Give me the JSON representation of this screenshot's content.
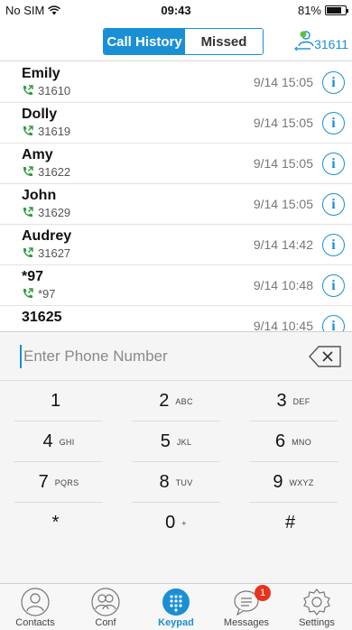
{
  "status": {
    "carrier": "No SIM",
    "time": "09:43",
    "battery": "81%",
    "battery_level": 0.81
  },
  "header": {
    "tabs": [
      {
        "label": "Call History"
      },
      {
        "label": "Missed"
      }
    ],
    "account": "31611"
  },
  "history": [
    {
      "name": "Emily",
      "number": "31610",
      "time": "9/14 15:05"
    },
    {
      "name": "Dolly",
      "number": "31619",
      "time": "9/14 15:05"
    },
    {
      "name": "Amy",
      "number": "31622",
      "time": "9/14 15:05"
    },
    {
      "name": "John",
      "number": "31629",
      "time": "9/14 15:05"
    },
    {
      "name": "Audrey",
      "number": "31627",
      "time": "9/14 14:42"
    },
    {
      "name": "*97",
      "number": "*97",
      "time": "9/14 10:48"
    },
    {
      "name": "31625",
      "number": "",
      "time": "9/14 10:45"
    }
  ],
  "dialer": {
    "placeholder": "Enter Phone Number",
    "keys": [
      {
        "digit": "1",
        "letters": ""
      },
      {
        "digit": "2",
        "letters": "ABC"
      },
      {
        "digit": "3",
        "letters": "DEF"
      },
      {
        "digit": "4",
        "letters": "GHI"
      },
      {
        "digit": "5",
        "letters": "JKL"
      },
      {
        "digit": "6",
        "letters": "MNO"
      },
      {
        "digit": "7",
        "letters": "PQRS"
      },
      {
        "digit": "8",
        "letters": "TUV"
      },
      {
        "digit": "9",
        "letters": "WXYZ"
      },
      {
        "digit": "*",
        "letters": ""
      },
      {
        "digit": "0",
        "letters": "+"
      },
      {
        "digit": "#",
        "letters": ""
      }
    ]
  },
  "tabbar": {
    "tabs": [
      {
        "label": "Contacts",
        "icon": "contacts-icon"
      },
      {
        "label": "Conf",
        "icon": "conference-icon"
      },
      {
        "label": "Keypad",
        "icon": "keypad-icon"
      },
      {
        "label": "Messages",
        "icon": "messages-icon",
        "badge": "1"
      },
      {
        "label": "Settings",
        "icon": "settings-icon"
      }
    ],
    "active": "Keypad"
  },
  "colors": {
    "accent": "#1a8fd6",
    "call_green": "#2e9b3a",
    "badge": "#e8331c"
  }
}
